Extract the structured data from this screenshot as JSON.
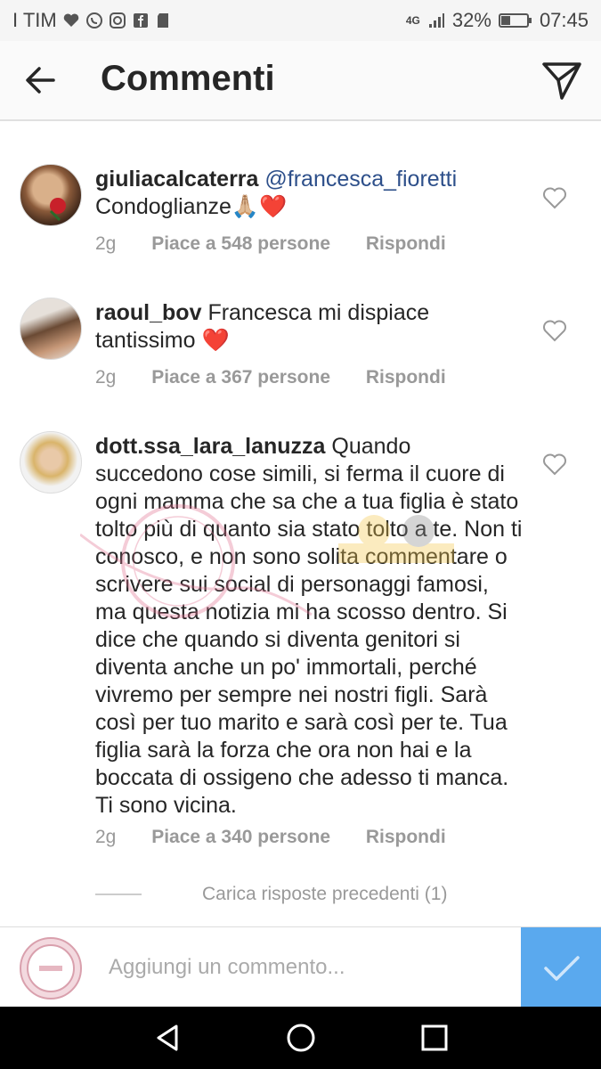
{
  "status_bar": {
    "carrier": "I TIM",
    "network": "4G",
    "battery": "32%",
    "time": "07:45"
  },
  "header": {
    "title": "Commenti"
  },
  "comments": [
    {
      "username": "giuliacalcaterra",
      "mention": "@francesca_fioretti",
      "text": "Condoglianze🙏🏼❤️",
      "time": "2g",
      "likes": "Piace a 548 persone",
      "reply": "Rispondi"
    },
    {
      "username": "raoul_bov",
      "mention": "",
      "text": "Francesca mi dispiace tantissimo ❤️",
      "time": "2g",
      "likes": "Piace a 367 persone",
      "reply": "Rispondi"
    },
    {
      "username": "dott.ssa_lara_lanuzza",
      "mention": "",
      "text": "Quando succedono cose simili, si ferma il cuore di ogni mamma che sa che a tua figlia è stato tolto più di quanto sia stato tolto a te. Non ti conosco, e non sono solita commentare o scrivere sui social di personaggi famosi, ma questa notizia mi ha scosso dentro. Si dice che quando si diventa genitori si diventa anche un po' immortali, perché vivremo per sempre nei nostri figli. Sarà così per tuo marito e sarà così per te. Tua figlia sarà la forza che ora non hai e la boccata di ossigeno che adesso ti manca. Ti sono vicina.",
      "time": "2g",
      "likes": "Piace a 340 persone",
      "reply": "Rispondi"
    }
  ],
  "load_more": "Carica risposte precedenti (1)",
  "input": {
    "placeholder": "Aggiungi un commento..."
  },
  "colors": {
    "accent": "#5aa9ee",
    "mention": "#2d4f8a",
    "meta": "#999999",
    "like_heart": "#e0242b"
  }
}
